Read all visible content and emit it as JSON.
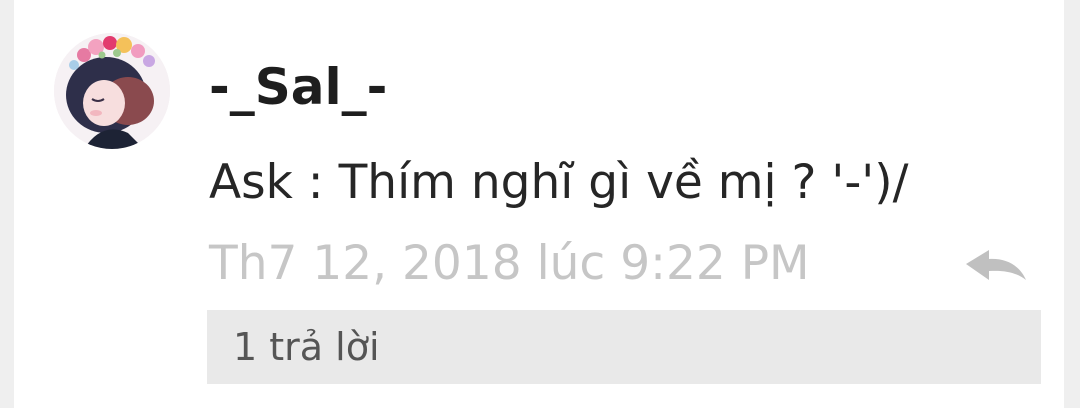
{
  "comment": {
    "username": "-_Sal_-",
    "message": "Ask : Thím nghĩ gì về mị ? '-')/",
    "timestamp": "Th7 12, 2018 lúc 9:22 PM",
    "replies_label": "1 trả lời",
    "reply_icon": "reply-arrow-icon",
    "avatar_icon": "avatar-illustration"
  },
  "colors": {
    "background": "#efefef",
    "card": "#ffffff",
    "username": "#1e1e1e",
    "message": "#262626",
    "timestamp": "#c6c6c6",
    "reply_icon": "#c0c0c0",
    "replies_bar": "#e9e9e9",
    "replies_text": "#555555"
  }
}
